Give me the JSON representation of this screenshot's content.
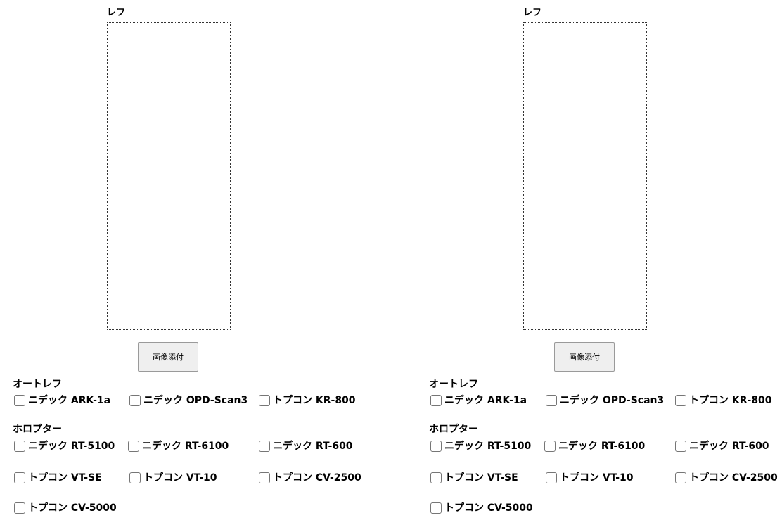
{
  "panels": [
    {
      "image_label": "レフ",
      "attach_button_label": "画像添付",
      "autoref": {
        "title": "オートレフ",
        "options": [
          {
            "label": "ニデック ARK-1a",
            "checked": false
          },
          {
            "label": "ニデック OPD-Scan3",
            "checked": false
          },
          {
            "label": "トプコン KR-800",
            "checked": false
          }
        ]
      },
      "phoropter": {
        "title": "ホロプター",
        "options": [
          {
            "label": "ニデック RT-5100",
            "checked": false
          },
          {
            "label": "ニデック RT-6100",
            "checked": false
          },
          {
            "label": "ニデック RT-600",
            "checked": false
          },
          {
            "label": "トプコン VT-SE",
            "checked": false
          },
          {
            "label": "トプコン VT-10",
            "checked": false
          },
          {
            "label": "トプコン CV-2500",
            "checked": false
          },
          {
            "label": "トプコン CV-5000",
            "checked": false
          }
        ]
      }
    },
    {
      "image_label": "レフ",
      "attach_button_label": "画像添付",
      "autoref": {
        "title": "オートレフ",
        "options": [
          {
            "label": "ニデック ARK-1a",
            "checked": false
          },
          {
            "label": "ニデック OPD-Scan3",
            "checked": false
          },
          {
            "label": "トプコン KR-800",
            "checked": false
          }
        ]
      },
      "phoropter": {
        "title": "ホロプター",
        "options": [
          {
            "label": "ニデック RT-5100",
            "checked": false
          },
          {
            "label": "ニデック RT-6100",
            "checked": false
          },
          {
            "label": "ニデック RT-600",
            "checked": false
          },
          {
            "label": "トプコン VT-SE",
            "checked": false
          },
          {
            "label": "トプコン VT-10",
            "checked": false
          },
          {
            "label": "トプコン CV-2500",
            "checked": false
          },
          {
            "label": "トプコン CV-5000",
            "checked": false
          }
        ]
      }
    }
  ]
}
